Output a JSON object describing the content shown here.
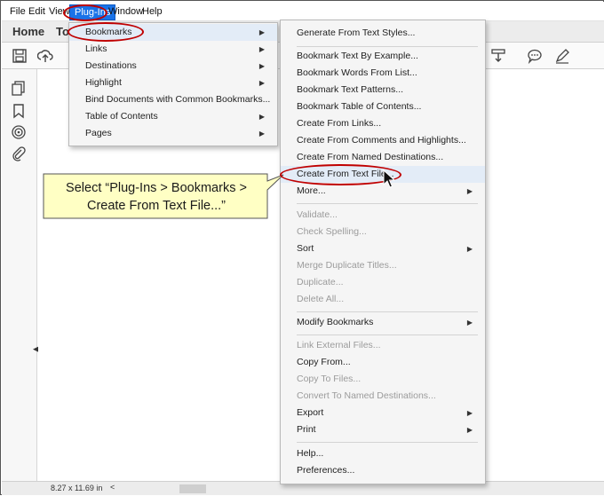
{
  "menubar": {
    "items": [
      "File",
      "Edit",
      "View",
      "Plug-Ins",
      "Window",
      "Help"
    ],
    "active_item": "Plug-Ins"
  },
  "tabs": {
    "home": "Home",
    "tools": "To"
  },
  "status": {
    "page_size": "8.27 x 11.69 in"
  },
  "plugins_menu": {
    "items": [
      {
        "label": "Bookmarks",
        "submenu": true,
        "highlighted": true
      },
      {
        "label": "Links",
        "submenu": true
      },
      {
        "label": "Destinations",
        "submenu": true
      },
      {
        "label": "Highlight",
        "submenu": true
      },
      {
        "label": "Bind Documents with Common Bookmarks...",
        "submenu": false
      },
      {
        "label": "Table of Contents",
        "submenu": true
      },
      {
        "label": "Pages",
        "submenu": true
      }
    ]
  },
  "bookmarks_menu": {
    "items": [
      {
        "label": "Generate From Text Styles...",
        "enabled": true
      },
      {
        "label": "Bookmark Text By Example...",
        "enabled": true
      },
      {
        "label": "Bookmark Words From List...",
        "enabled": true
      },
      {
        "label": "Bookmark Text Patterns...",
        "enabled": true
      },
      {
        "label": "Bookmark Table of Contents...",
        "enabled": true
      },
      {
        "label": "Create From Links...",
        "enabled": true
      },
      {
        "label": "Create From Comments and Highlights...",
        "enabled": true
      },
      {
        "label": "Create From Named Destinations...",
        "enabled": true
      },
      {
        "label": "Create From Text File...",
        "enabled": true,
        "highlighted": true
      },
      {
        "label": "More...",
        "enabled": true,
        "submenu": true
      },
      {
        "label": "Validate...",
        "enabled": false
      },
      {
        "label": "Check Spelling...",
        "enabled": false
      },
      {
        "label": "Sort",
        "enabled": true,
        "submenu": true
      },
      {
        "label": "Merge Duplicate Titles...",
        "enabled": false
      },
      {
        "label": "Duplicate...",
        "enabled": false
      },
      {
        "label": "Delete All...",
        "enabled": false
      },
      {
        "label": "Modify Bookmarks",
        "enabled": true,
        "submenu": true
      },
      {
        "label": "Link External Files...",
        "enabled": false
      },
      {
        "label": "Copy From...",
        "enabled": true
      },
      {
        "label": "Copy To Files...",
        "enabled": false
      },
      {
        "label": "Convert To Named Destinations...",
        "enabled": false
      },
      {
        "label": "Export",
        "enabled": true,
        "submenu": true
      },
      {
        "label": "Print",
        "enabled": true,
        "submenu": true
      },
      {
        "label": "Help...",
        "enabled": true
      },
      {
        "label": "Preferences...",
        "enabled": true
      }
    ]
  },
  "callout": {
    "line1": "Select “Plug-Ins > Bookmarks >",
    "line2": "Create From Text File...”"
  },
  "colors": {
    "annotation_red": "#c00000",
    "callout_fill": "#ffffc4",
    "menu_active": "#1a73e8"
  }
}
